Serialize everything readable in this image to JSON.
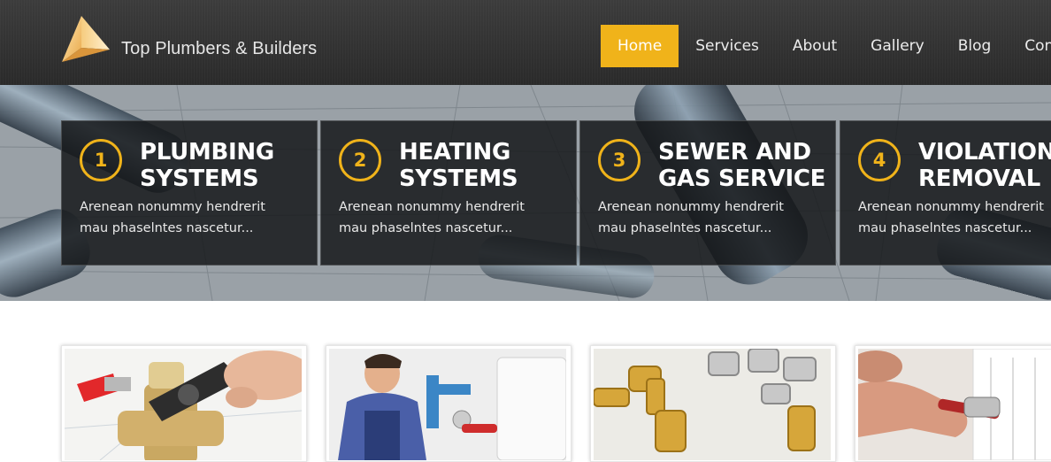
{
  "site": {
    "title": "Top Plumbers & Builders",
    "logo_icon": "pyramid-logo-icon"
  },
  "nav": {
    "items": [
      {
        "label": "Home",
        "active": true
      },
      {
        "label": "Services",
        "active": false
      },
      {
        "label": "About",
        "active": false
      },
      {
        "label": "Gallery",
        "active": false
      },
      {
        "label": "Blog",
        "active": false
      },
      {
        "label": "Cont",
        "active": false
      }
    ]
  },
  "features": [
    {
      "number": "1",
      "title_line1": "PLUMBING",
      "title_line2": "SYSTEMS",
      "desc_line1": "Arenean nonummy hendrerit",
      "desc_line2": "mau phaselntes nascetur..."
    },
    {
      "number": "2",
      "title_line1": "HEATING",
      "title_line2": "SYSTEMS",
      "desc_line1": "Arenean nonummy hendrerit",
      "desc_line2": "mau phaselntes nascetur..."
    },
    {
      "number": "3",
      "title_line1": "SEWER AND",
      "title_line2": "GAS SERVICE",
      "desc_line1": "Arenean nonummy hendrerit",
      "desc_line2": "mau phaselntes nascetur..."
    },
    {
      "number": "4",
      "title_line1": "VIOLATION",
      "title_line2": "REMOVAL",
      "desc_line1": "Arenean nonummy hendrerit",
      "desc_line2": "mau phaselntes nascetur..."
    }
  ],
  "gallery": {
    "items": [
      "valve-wrench-photo",
      "plumber-worker-photo",
      "brass-fittings-photo",
      "radiator-repair-photo"
    ]
  },
  "colors": {
    "accent": "#f0b31a",
    "header_bg": "#333333",
    "feature_box_bg": "#16181b"
  }
}
